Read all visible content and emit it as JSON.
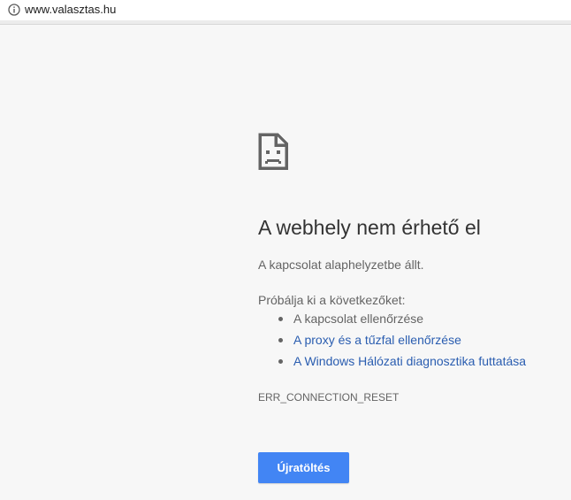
{
  "address_bar": {
    "url": "www.valasztas.hu",
    "info_icon": "info-circle-icon"
  },
  "error_page": {
    "icon": "sad-document-icon",
    "title": "A webhely nem érhető el",
    "message": "A kapcsolat alaphelyzetbe állt.",
    "suggestions_heading": "Próbálja ki a következőket:",
    "suggestions": [
      {
        "label": "A kapcsolat ellenőrzése",
        "is_link": false
      },
      {
        "label": "A proxy és a tűzfal ellenőrzése",
        "is_link": true
      },
      {
        "label": "A Windows Hálózati diagnosztika futtatása",
        "is_link": true
      }
    ],
    "error_code": "ERR_CONNECTION_RESET",
    "reload_label": "Újratöltés"
  },
  "colors": {
    "background": "#f7f7f7",
    "link": "#2a5db0",
    "button": "#4285f4",
    "text": "#646464",
    "title": "#333333"
  }
}
